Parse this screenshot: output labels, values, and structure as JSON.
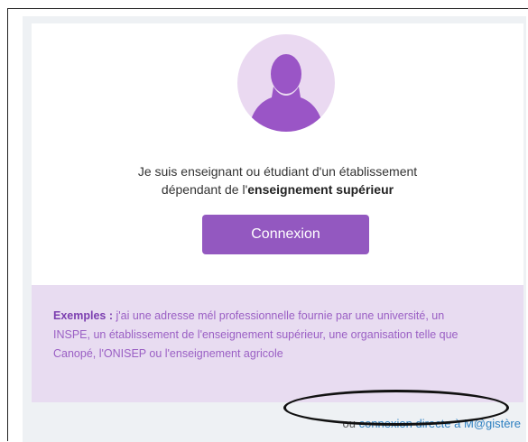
{
  "intro": {
    "line1": "Je suis enseignant ou étudiant d'un établissement",
    "line2_prefix": "dépendant de l'",
    "line2_bold": "enseignement supérieur"
  },
  "login_button": {
    "label": "Connexion"
  },
  "examples": {
    "label": "Exemples :",
    "text": " j'ai une adresse mél professionnelle fournie par une université, un INSPE, un établissement de l'enseignement supérieur, une organisation telle que Canopé, l'ONISEP ou l'enseignement agricole"
  },
  "direct_link": {
    "prefix": "ou ",
    "label": "connexion directe à M@gistère"
  },
  "colors": {
    "accent": "#9358c0",
    "examples_bg": "#e8dcf1",
    "avatar_bg": "#ead9f1",
    "link": "#2c7fc0"
  },
  "icons": {
    "avatar": "user-silhouette-icon",
    "annotation": "hand-drawn-ellipse"
  }
}
